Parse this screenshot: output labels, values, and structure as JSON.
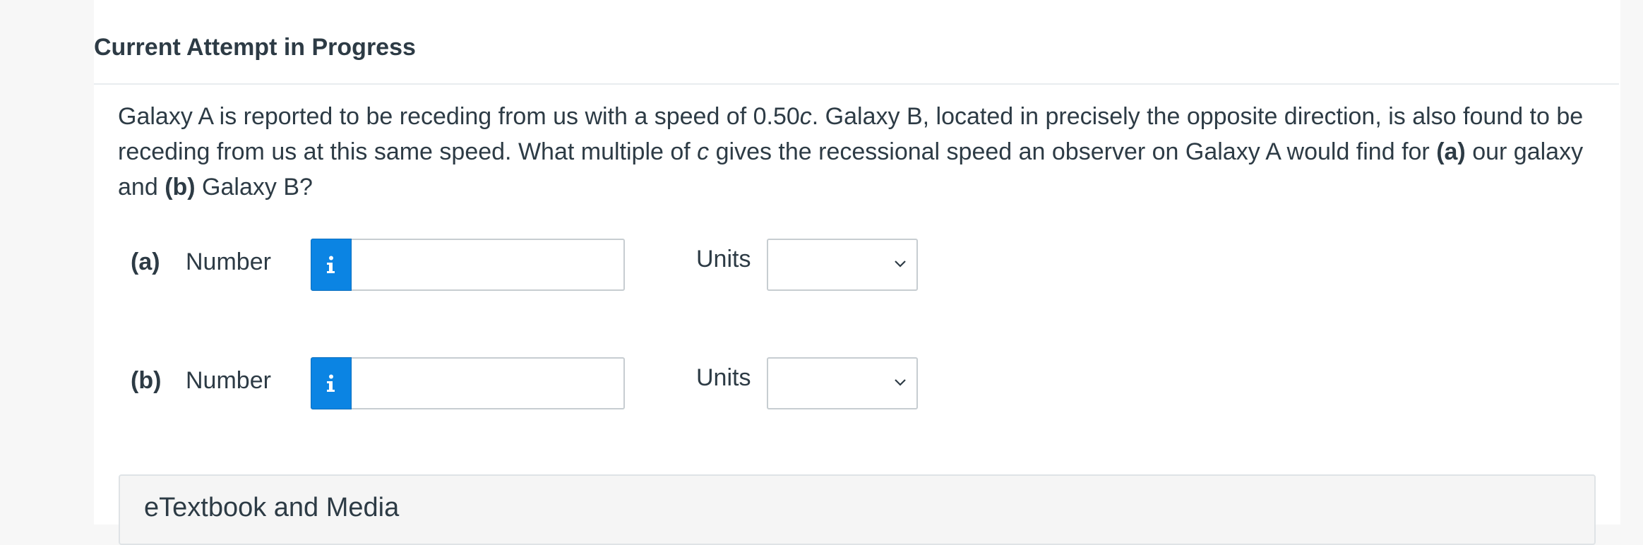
{
  "attempt": {
    "heading": "Current Attempt in Progress"
  },
  "question": {
    "text_1": "Galaxy A is reported to be receding from us with a speed of 0.50",
    "c_symbol": "c",
    "text_2": ". Galaxy B, located in precisely the opposite direction, is also found to be receding from us at this same speed. What multiple of ",
    "c_symbol_2": "c",
    "text_3": " gives the recessional speed an observer on Galaxy A would find for ",
    "part_a": "(a)",
    "text_4": " our galaxy and ",
    "part_b": "(b)",
    "text_5": " Galaxy B?"
  },
  "answers": [
    {
      "part_label": "(a)",
      "number_label": "Number",
      "number_value": "",
      "units_label": "Units",
      "units_selected": ""
    },
    {
      "part_label": "(b)",
      "number_label": "Number",
      "number_value": "",
      "units_label": "Units",
      "units_selected": ""
    }
  ],
  "etextbook": {
    "title": "eTextbook and Media"
  },
  "icons": {
    "info": "info-icon",
    "select": "chevron-down-icon"
  },
  "colors": {
    "info_button": "#0b84e3",
    "text": "#2d3b45",
    "border": "#c7cdd1"
  }
}
